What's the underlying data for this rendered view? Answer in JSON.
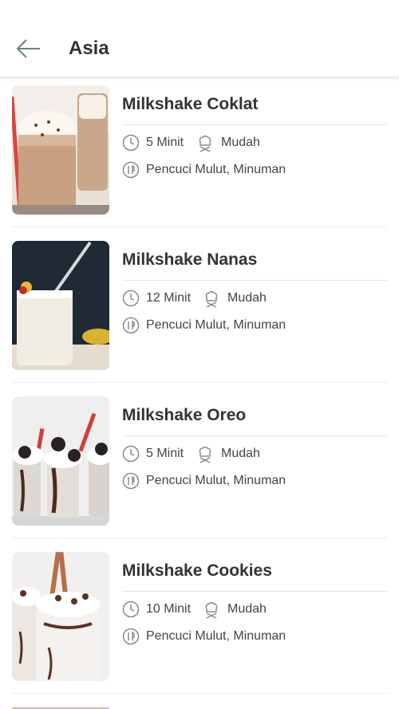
{
  "header": {
    "title": "Asia",
    "back_icon": "arrow-left-icon"
  },
  "recipes": [
    {
      "title": "Milkshake Coklat",
      "time": "5 Minit",
      "difficulty": "Mudah",
      "category": "Pencuci Mulut, Minuman"
    },
    {
      "title": "Milkshake Nanas",
      "time": "12 Minit",
      "difficulty": "Mudah",
      "category": "Pencuci Mulut, Minuman"
    },
    {
      "title": "Milkshake Oreo",
      "time": "5 Minit",
      "difficulty": "Mudah",
      "category": "Pencuci Mulut, Minuman"
    },
    {
      "title": "Milkshake Cookies",
      "time": "10 Minit",
      "difficulty": "Mudah",
      "category": "Pencuci Mulut, Minuman"
    }
  ],
  "colors": {
    "title": "#333333",
    "meta_text": "#444444",
    "icon": "#8a8a8a",
    "divider": "#ececec"
  }
}
